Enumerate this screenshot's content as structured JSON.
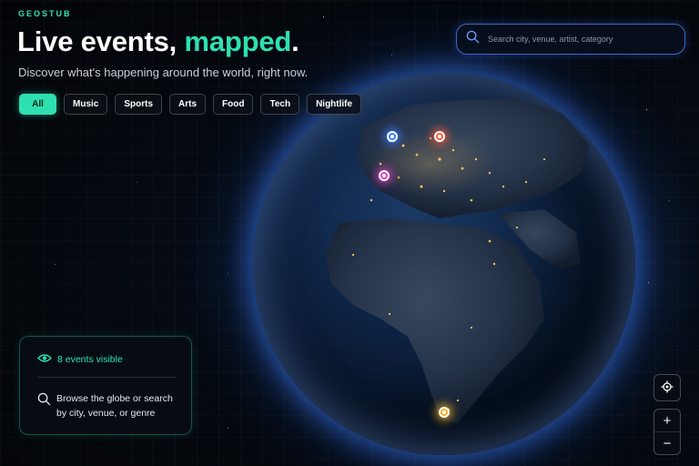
{
  "brand": "GEOSTUB",
  "headline": {
    "main": "Live events, ",
    "accent": "mapped",
    "end": "."
  },
  "subtitle": "Discover what's happening around the world, right now.",
  "filters": [
    "All",
    "Music",
    "Sports",
    "Arts",
    "Food",
    "Tech",
    "Nightlife"
  ],
  "active_filter": "All",
  "search": {
    "placeholder": "Search city, venue, artist, category",
    "icon": "search-icon"
  },
  "panel": {
    "count_text": "8 events visible",
    "count_icon": "eye-icon",
    "hint_text": "Browse the globe or search by city, venue, or genre",
    "hint_icon": "search-icon"
  },
  "controls": {
    "locate_icon": "crosshair-icon",
    "zoom_in": "+",
    "zoom_out": "−"
  },
  "markers": [
    {
      "name": "event-marker-blue",
      "color": "#3f7bff"
    },
    {
      "name": "event-marker-red",
      "color": "#ff5a3c"
    },
    {
      "name": "event-marker-magenta",
      "color": "#e040c8"
    },
    {
      "name": "event-marker-yellow",
      "color": "#f4b428"
    }
  ],
  "colors": {
    "accent": "#2ee0b0",
    "search_border": "#3f66c8",
    "background": "#04070d"
  }
}
